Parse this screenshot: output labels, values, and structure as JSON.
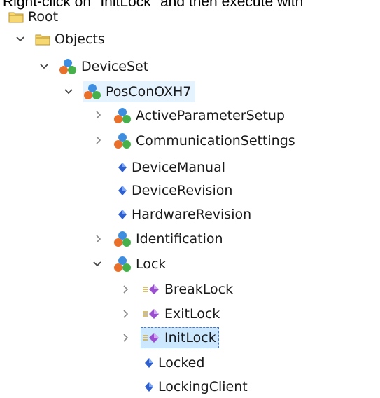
{
  "caption": "Right-click on \"InitLock\" and then execute with",
  "tree": {
    "root": "Root",
    "objects": "Objects",
    "device_set": "DeviceSet",
    "device": "PosConOXH7",
    "active_parameter_setup": "ActiveParameterSetup",
    "communication_settings": "CommunicationSettings",
    "device_manual": "DeviceManual",
    "device_revision": "DeviceRevision",
    "hardware_revision": "HardwareRevision",
    "identification": "Identification",
    "lock": "Lock",
    "break_lock": "BreakLock",
    "exit_lock": "ExitLock",
    "init_lock": "InitLock",
    "locked": "Locked",
    "locking_client": "LockingClient"
  },
  "selected_item": "InitLock",
  "colors": {
    "selection_bg": "#cce8ff",
    "selection_border": "#3a7bd5",
    "folder": "#e8c15a",
    "variable": "#2f5fcf",
    "method": "#9b4fd0"
  },
  "icons": {
    "folder": "folder-icon",
    "object": "object-icon",
    "variable": "variable-icon",
    "method": "method-icon",
    "expanded": "chevron-down-icon",
    "collapsed": "chevron-right-icon"
  }
}
